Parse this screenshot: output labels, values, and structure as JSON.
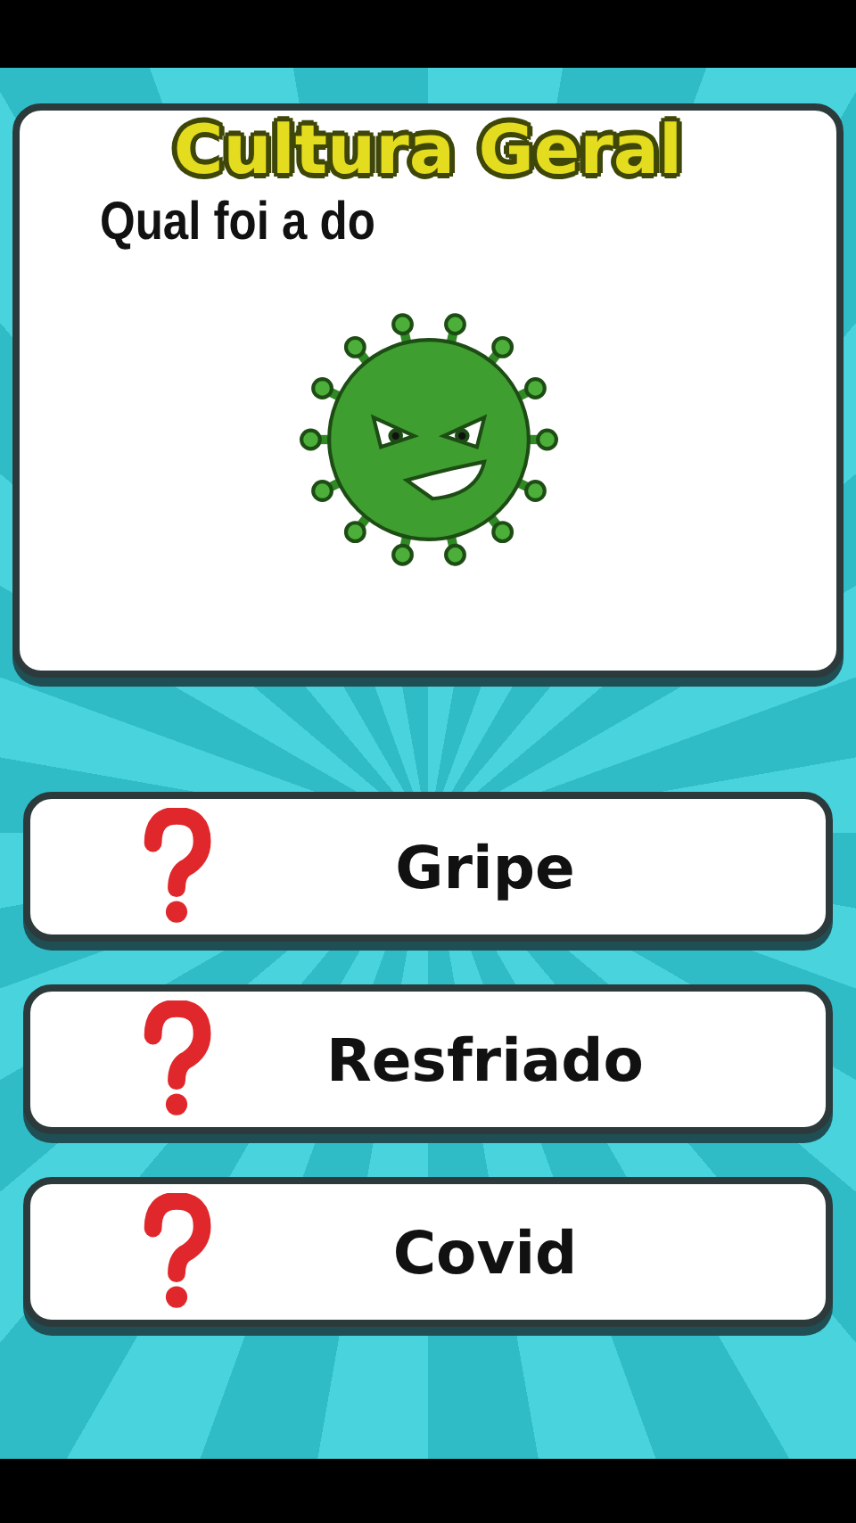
{
  "title": "Cultura Geral",
  "question": "Qual foi a do",
  "answers": [
    {
      "label": "Gripe"
    },
    {
      "label": "Resfriado"
    },
    {
      "label": "Covid"
    }
  ]
}
